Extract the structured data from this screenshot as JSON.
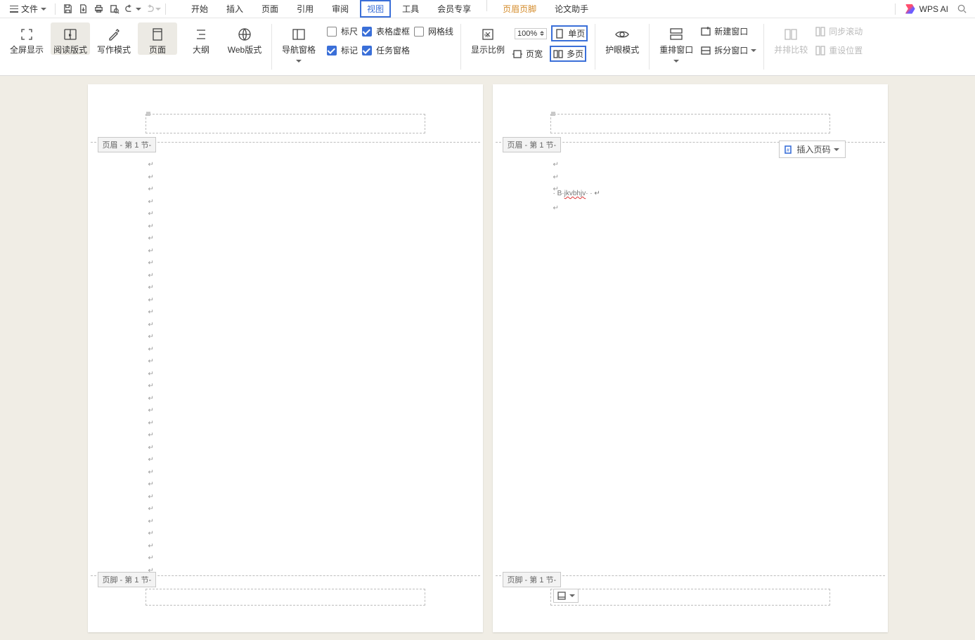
{
  "titlebar": {
    "file_label": "文件"
  },
  "menu": {
    "tabs": [
      "开始",
      "插入",
      "页面",
      "引用",
      "审阅",
      "视图",
      "工具",
      "会员专享"
    ],
    "active_index": 5,
    "context_tab": "页眉页脚",
    "thesis_tab": "论文助手",
    "wps_ai": "WPS AI"
  },
  "ribbon": {
    "views": {
      "fullscreen": "全屏显示",
      "read": "阅读版式",
      "write": "写作模式",
      "page": "页面",
      "outline": "大纲",
      "web": "Web版式"
    },
    "nav_pane": "导航窗格",
    "checks": {
      "ruler": "标尺",
      "table_frame": "表格虚框",
      "grid": "网格线",
      "marks": "标记",
      "task_pane": "任务窗格"
    },
    "zoom": {
      "show_ratio": "显示比例",
      "percent": "100%",
      "page_width": "页宽",
      "single_page": "单页",
      "multi_page": "多页"
    },
    "eye": "护眼模式",
    "window": {
      "arrange": "重排窗口",
      "new": "新建窗口",
      "split": "拆分窗口"
    },
    "compare": {
      "side": "并排比较",
      "sync_scroll": "同步滚动",
      "reset_pos": "重设位置"
    }
  },
  "doc": {
    "header_tag": "页眉  - 第 1 节-",
    "footer_tag": "页脚  - 第 1 节-",
    "insert_page_num": "插入页码",
    "page2_text_prefix": "B",
    "page2_text_mis": "jkvbhjv"
  }
}
